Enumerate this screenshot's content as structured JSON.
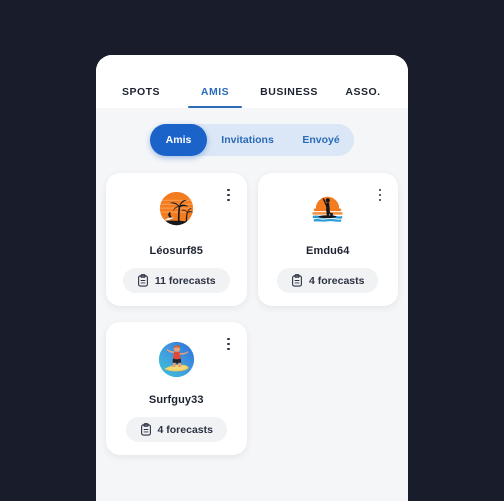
{
  "app": {
    "background_color": "#191c2a",
    "screen_background": "#f5f6f8",
    "accent_color": "#2b6cb8",
    "pill_active_color": "#1b63c9",
    "pill_track_color": "#dbe7f6"
  },
  "tabs": [
    {
      "label": "SPOTS",
      "active": false,
      "name": "tab-spots"
    },
    {
      "label": "AMIS",
      "active": true,
      "name": "tab-amis"
    },
    {
      "label": "BUSINESS",
      "active": false,
      "name": "tab-business"
    },
    {
      "label": "ASSO.",
      "active": false,
      "name": "tab-asso"
    }
  ],
  "segmented_control": {
    "segments": [
      {
        "label": "Amis",
        "active": true,
        "name": "segment-amis"
      },
      {
        "label": "Invitations",
        "active": false,
        "name": "segment-invitations"
      },
      {
        "label": "Envoye",
        "active": false,
        "name": "segment-envoye"
      }
    ]
  },
  "friends": [
    {
      "name": "Léosurf85",
      "forecasts_label": "11 forecasts",
      "forecast_count": 11,
      "avatar": "palm-sunset-surfer-avatar",
      "menu_icon": "kebab-menu-icon",
      "badge_icon": "clipboard-icon"
    },
    {
      "name": "Emdu64",
      "forecasts_label": "4 forecasts",
      "forecast_count": 4,
      "avatar": "paddleboard-sunset-avatar",
      "menu_icon": "kebab-menu-icon",
      "badge_icon": "clipboard-icon"
    },
    {
      "name": "Surfguy33",
      "forecasts_label": "4 forecasts",
      "forecast_count": 4,
      "avatar": "surfer-blue-circle-avatar",
      "menu_icon": "kebab-menu-icon",
      "badge_icon": "clipboard-icon"
    }
  ],
  "segment_labels_display": {
    "envoye": "Envoyé"
  }
}
